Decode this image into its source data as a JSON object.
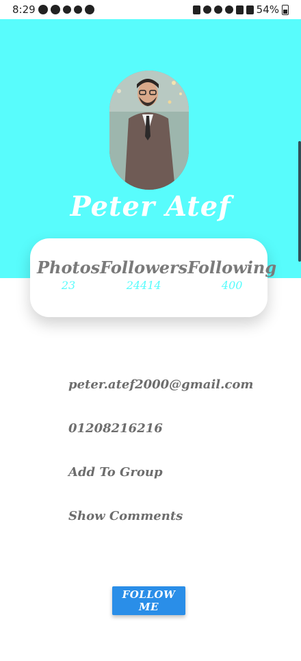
{
  "status_bar": {
    "time": "8:29",
    "battery": "54%"
  },
  "profile": {
    "name": "Peter Atef"
  },
  "stats": [
    {
      "label": "Photos",
      "value": "23"
    },
    {
      "label": "Followers",
      "value": "24414"
    },
    {
      "label": "Following",
      "value": "400"
    }
  ],
  "info": {
    "email": "peter.atef2000@gmail.com",
    "phone": "01208216216",
    "add_group": "Add To Group",
    "show_comments": "Show Comments"
  },
  "actions": {
    "follow_label": "FOLLOW ME"
  },
  "colors": {
    "header": "#58fcfc",
    "button": "#2a8ee8",
    "text_gray": "#6d6d6d"
  }
}
